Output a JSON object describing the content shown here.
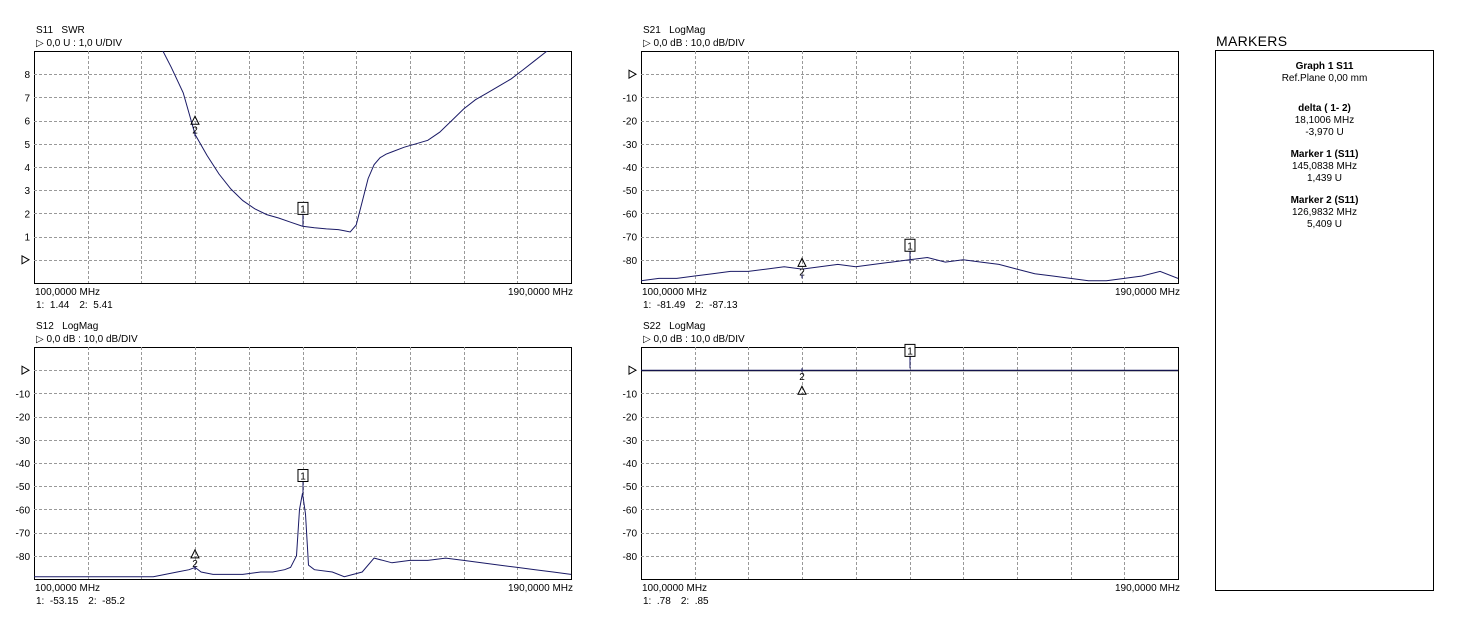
{
  "markers_panel": {
    "title": "MARKERS",
    "graph_heading": "Graph 1 S11",
    "ref_plane": "Ref.Plane 0,00 mm",
    "blocks": [
      {
        "heading": "delta ( 1- 2)",
        "line1": "18,1006 MHz",
        "line2": "-3,970 U"
      },
      {
        "heading": "Marker  1 (S11)",
        "line1": "145,0838 MHz",
        "line2": "1,439 U"
      },
      {
        "heading": "Marker  2 (S11)",
        "line1": "126,9832 MHz",
        "line2": "5,409 U"
      }
    ]
  },
  "chart_data": [
    {
      "type": "line",
      "param": "S11",
      "format": "SWR",
      "scale_text": "0,0 U : 1,0 U/DIV",
      "ref_value": 0,
      "xlim": [
        100,
        190
      ],
      "ylim": [
        -1,
        9
      ],
      "y_ticks": [
        "8",
        "7",
        "6",
        "5",
        "4",
        "3",
        "2",
        "1"
      ],
      "y_tick_values": [
        8,
        7,
        6,
        5,
        4,
        3,
        2,
        1
      ],
      "x_start_label": "100,0000 MHz",
      "x_stop_label": "190,0000 MHz",
      "readout": [
        "1:  1.44",
        "2:  5.41"
      ],
      "markers": [
        {
          "label": "1",
          "x": 145.08,
          "y": 1.44
        },
        {
          "label": "2",
          "x": 126.98,
          "y": 5.41
        }
      ],
      "series": [
        {
          "x": [
            121,
            123,
            125,
            127,
            129,
            131,
            133,
            135,
            137,
            139,
            141,
            143,
            145,
            147,
            149,
            151,
            152,
            153,
            154,
            155,
            156,
            157,
            158,
            159,
            160,
            162,
            164,
            166,
            168,
            170,
            172,
            174,
            176,
            178,
            180,
            182,
            184,
            186,
            188,
            190
          ],
          "y": [
            9.3,
            8.3,
            7.2,
            5.4,
            4.5,
            3.7,
            3.05,
            2.55,
            2.2,
            1.95,
            1.8,
            1.62,
            1.45,
            1.38,
            1.33,
            1.3,
            1.25,
            1.2,
            1.5,
            2.5,
            3.5,
            4.1,
            4.4,
            4.55,
            4.65,
            4.85,
            5.0,
            5.15,
            5.5,
            6.0,
            6.5,
            6.9,
            7.2,
            7.5,
            7.8,
            8.2,
            8.6,
            9.0,
            9.3,
            9.4
          ]
        }
      ]
    },
    {
      "type": "line",
      "param": "S21",
      "format": "LogMag",
      "scale_text": "0,0 dB : 10,0 dB/DIV",
      "ref_value": 0,
      "xlim": [
        100,
        190
      ],
      "ylim": [
        -90,
        10
      ],
      "y_ticks": [
        "-10",
        "-20",
        "-30",
        "-40",
        "-50",
        "-60",
        "-70",
        "-80"
      ],
      "y_tick_values": [
        -10,
        -20,
        -30,
        -40,
        -50,
        -60,
        -70,
        -80
      ],
      "x_start_label": "100,0000 MHz",
      "x_stop_label": "190,0000 MHz",
      "readout": [
        "1:  -81.49",
        "2:  -87.13"
      ],
      "markers": [
        {
          "label": "1",
          "x": 145.08,
          "y": -81.49
        },
        {
          "label": "2",
          "x": 126.98,
          "y": -87.13
        }
      ],
      "series": [
        {
          "x": [
            100,
            103,
            106,
            109,
            112,
            115,
            118,
            121,
            124,
            127,
            130,
            133,
            136,
            139,
            142,
            145,
            148,
            151,
            154,
            157,
            160,
            163,
            166,
            169,
            172,
            175,
            178,
            181,
            184,
            187,
            190
          ],
          "y": [
            -89,
            -88,
            -88,
            -87,
            -86,
            -85,
            -85,
            -84,
            -83,
            -84,
            -83,
            -82,
            -83,
            -82,
            -81,
            -80,
            -79,
            -81,
            -80,
            -81,
            -82,
            -84,
            -86,
            -87,
            -88,
            -89,
            -89,
            -88,
            -87,
            -85,
            -88
          ]
        }
      ]
    },
    {
      "type": "line",
      "param": "S12",
      "format": "LogMag",
      "scale_text": "0,0 dB : 10,0 dB/DIV",
      "ref_value": 0,
      "xlim": [
        100,
        190
      ],
      "ylim": [
        -90,
        10
      ],
      "y_ticks": [
        "-10",
        "-20",
        "-30",
        "-40",
        "-50",
        "-60",
        "-70",
        "-80"
      ],
      "y_tick_values": [
        -10,
        -20,
        -30,
        -40,
        -50,
        -60,
        -70,
        -80
      ],
      "x_start_label": "100,0000 MHz",
      "x_stop_label": "190,0000 MHz",
      "readout": [
        "1:  -53.15",
        "2:  -85.2"
      ],
      "markers": [
        {
          "label": "1",
          "x": 145.08,
          "y": -53.15
        },
        {
          "label": "2",
          "x": 126.98,
          "y": -85.2
        }
      ],
      "series": [
        {
          "x": [
            100,
            105,
            110,
            115,
            120,
            122,
            124,
            126,
            127,
            128,
            130,
            132,
            135,
            138,
            140,
            142,
            143,
            144,
            144.5,
            145,
            145.5,
            146,
            147,
            150,
            152,
            155,
            157,
            160,
            163,
            166,
            169,
            172,
            175,
            178,
            181,
            184,
            187,
            190
          ],
          "y": [
            -89,
            -89,
            -89,
            -89,
            -89,
            -88,
            -87,
            -86,
            -85,
            -87,
            -88,
            -88,
            -88,
            -87,
            -87,
            -86,
            -85,
            -80,
            -60,
            -53,
            -62,
            -84,
            -86,
            -87,
            -89,
            -87,
            -81,
            -83,
            -82,
            -82,
            -81,
            -82,
            -83,
            -84,
            -85,
            -86,
            -87,
            -88
          ]
        }
      ]
    },
    {
      "type": "line",
      "param": "S22",
      "format": "LogMag",
      "scale_text": "0,0 dB : 10,0 dB/DIV",
      "ref_value": 0,
      "xlim": [
        100,
        190
      ],
      "ylim": [
        -90,
        10
      ],
      "y_ticks": [
        "-10",
        "-20",
        "-30",
        "-40",
        "-50",
        "-60",
        "-70",
        "-80"
      ],
      "y_tick_values": [
        -10,
        -20,
        -30,
        -40,
        -50,
        -60,
        -70,
        -80
      ],
      "x_start_label": "100,0000 MHz",
      "x_stop_label": "190,0000 MHz",
      "readout": [
        "1:  .78",
        "2:  .85"
      ],
      "markers": [
        {
          "label": "1",
          "x": 145.08,
          "y": 0.78
        },
        {
          "label": "2",
          "x": 126.98,
          "y": 0.85
        }
      ],
      "series": [
        {
          "x": [
            100,
            190
          ],
          "y": [
            0,
            0
          ]
        }
      ]
    }
  ]
}
